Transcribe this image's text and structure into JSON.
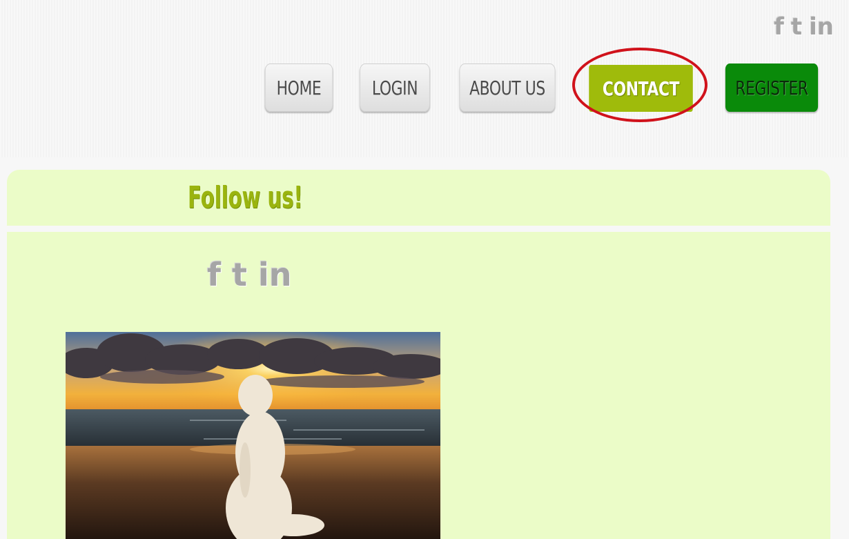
{
  "top_social": {
    "facebook": "f",
    "twitter": "t",
    "linkedin": "in"
  },
  "nav": {
    "items": [
      {
        "label": "HOME"
      },
      {
        "label": "LOGIN"
      },
      {
        "label": "ABOUT US"
      },
      {
        "label": "CONTACT"
      },
      {
        "label": "REGISTER"
      }
    ],
    "highlighted": "CONTACT"
  },
  "panel": {
    "title": "Follow us!"
  },
  "body_social": {
    "facebook": "f",
    "twitter": "t",
    "linkedin": "in"
  },
  "colors": {
    "contact_bg": "#9fbb0b",
    "register_bg": "#0a8a0a",
    "panel_bg": "#ebfcc8",
    "title": "#9ab40f",
    "highlight_ring": "#d0121b"
  }
}
